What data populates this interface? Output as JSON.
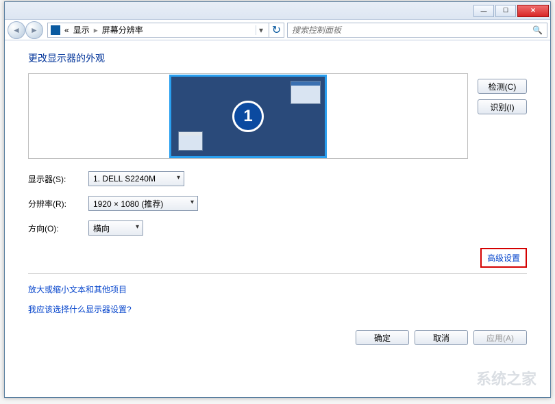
{
  "window": {
    "minimize": "—",
    "maximize": "☐",
    "close": "✕"
  },
  "breadcrumb": {
    "prefix": "«",
    "item1": "显示",
    "sep": "▸",
    "item2": "屏幕分辨率"
  },
  "search": {
    "placeholder": "搜索控制面板"
  },
  "heading": "更改显示器的外观",
  "monitor_number": "1",
  "side": {
    "detect": "检测(C)",
    "identify": "识别(I)"
  },
  "fields": {
    "display_label": "显示器(S):",
    "display_value": "1. DELL S2240M",
    "resolution_label": "分辨率(R):",
    "resolution_value": "1920 × 1080 (推荐)",
    "orientation_label": "方向(O):",
    "orientation_value": "横向"
  },
  "advanced": "高级设置",
  "links": {
    "textsize": "放大或缩小文本和其他项目",
    "which": "我应该选择什么显示器设置?"
  },
  "buttons": {
    "ok": "确定",
    "cancel": "取消",
    "apply": "应用(A)"
  },
  "watermark": "系统之家"
}
